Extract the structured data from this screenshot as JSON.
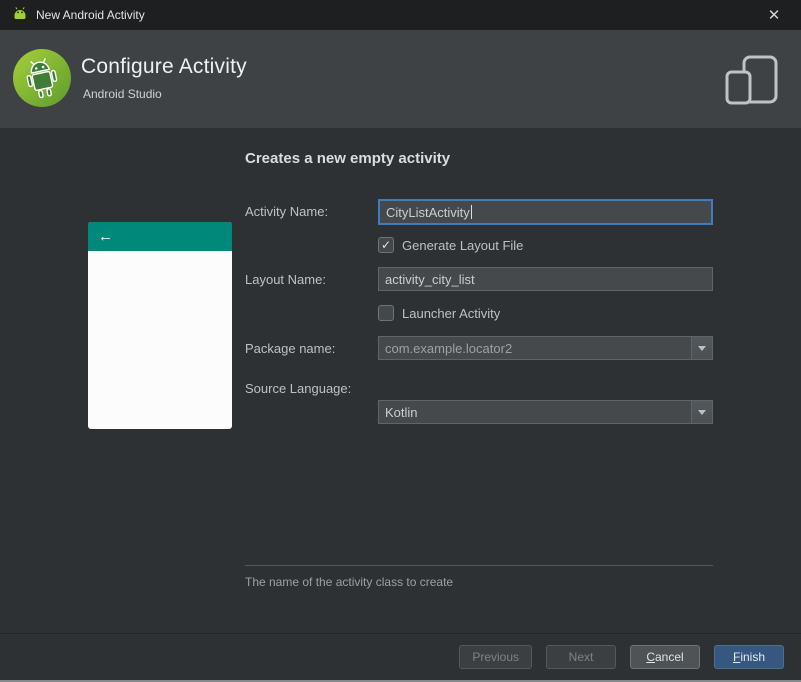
{
  "window": {
    "title": "New Android Activity",
    "close_glyph": "✕"
  },
  "header": {
    "title": "Configure Activity",
    "subtitle": "Android Studio"
  },
  "content": {
    "heading": "Creates a new empty activity",
    "hint": "The name of the activity class to create"
  },
  "preview": {
    "back_glyph": "←"
  },
  "form": {
    "activity_name_label": "Activity Name:",
    "activity_name_value": "CityListActivity",
    "generate_layout_label": "Generate Layout File",
    "generate_layout_checked": true,
    "check_glyph": "✓",
    "layout_name_label": "Layout Name:",
    "layout_name_value": "activity_city_list",
    "launcher_label": "Launcher Activity",
    "launcher_checked": false,
    "package_label": "Package name:",
    "package_value": "com.example.locator2",
    "language_label": "Source Language:",
    "language_value": "Kotlin"
  },
  "footer": {
    "previous": "Previous",
    "next": "Next",
    "cancel": "Cancel",
    "finish": "Finish"
  },
  "colors": {
    "preview_teal": "#00897b",
    "focus_border": "#3f7cc0",
    "finish_bg": "#365880",
    "header_bg": "#3e4245",
    "content_bg": "#2e3134"
  }
}
